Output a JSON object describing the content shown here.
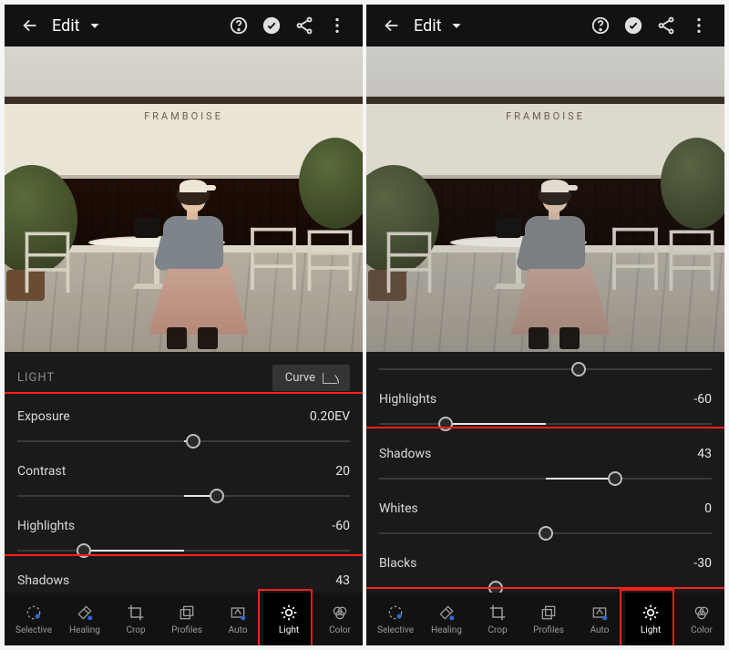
{
  "left": {
    "header": {
      "title": "Edit"
    },
    "photo": {
      "sign": "FRAMBOISE"
    },
    "section_title": "LIGHT",
    "curve_label": "Curve",
    "sliders": {
      "exposure": {
        "label": "Exposure",
        "value": "0.20EV",
        "pct": 53,
        "fill_from": 50,
        "fill_to": 53
      },
      "contrast": {
        "label": "Contrast",
        "value": "20",
        "pct": 60,
        "fill_from": 50,
        "fill_to": 60
      },
      "highlights": {
        "label": "Highlights",
        "value": "-60",
        "pct": 20,
        "fill_from": 20,
        "fill_to": 50
      },
      "shadows_peek": {
        "label": "Shadows",
        "value": "43"
      }
    },
    "toolbar": {
      "items": [
        {
          "key": "selective",
          "label": "Selective"
        },
        {
          "key": "healing",
          "label": "Healing"
        },
        {
          "key": "crop",
          "label": "Crop"
        },
        {
          "key": "profiles",
          "label": "Profiles"
        },
        {
          "key": "auto",
          "label": "Auto"
        },
        {
          "key": "light",
          "label": "Light"
        },
        {
          "key": "color",
          "label": "Color"
        }
      ],
      "active": "light"
    }
  },
  "right": {
    "header": {
      "title": "Edit"
    },
    "photo": {
      "sign": "FRAMBOISE"
    },
    "sliders": {
      "top_peek": {
        "pct": 60
      },
      "highlights": {
        "label": "Highlights",
        "value": "-60",
        "pct": 20,
        "fill_from": 20,
        "fill_to": 50
      },
      "shadows": {
        "label": "Shadows",
        "value": "43",
        "pct": 71,
        "fill_from": 50,
        "fill_to": 71
      },
      "whites": {
        "label": "Whites",
        "value": "0",
        "pct": 50,
        "fill_from": 50,
        "fill_to": 50
      },
      "blacks": {
        "label": "Blacks",
        "value": "-30",
        "pct": 35,
        "fill_from": 35,
        "fill_to": 50
      }
    },
    "toolbar": {
      "items": [
        {
          "key": "selective",
          "label": "Selective"
        },
        {
          "key": "healing",
          "label": "Healing"
        },
        {
          "key": "crop",
          "label": "Crop"
        },
        {
          "key": "profiles",
          "label": "Profiles"
        },
        {
          "key": "auto",
          "label": "Auto"
        },
        {
          "key": "light",
          "label": "Light"
        },
        {
          "key": "color",
          "label": "Color"
        }
      ],
      "active": "light"
    }
  }
}
